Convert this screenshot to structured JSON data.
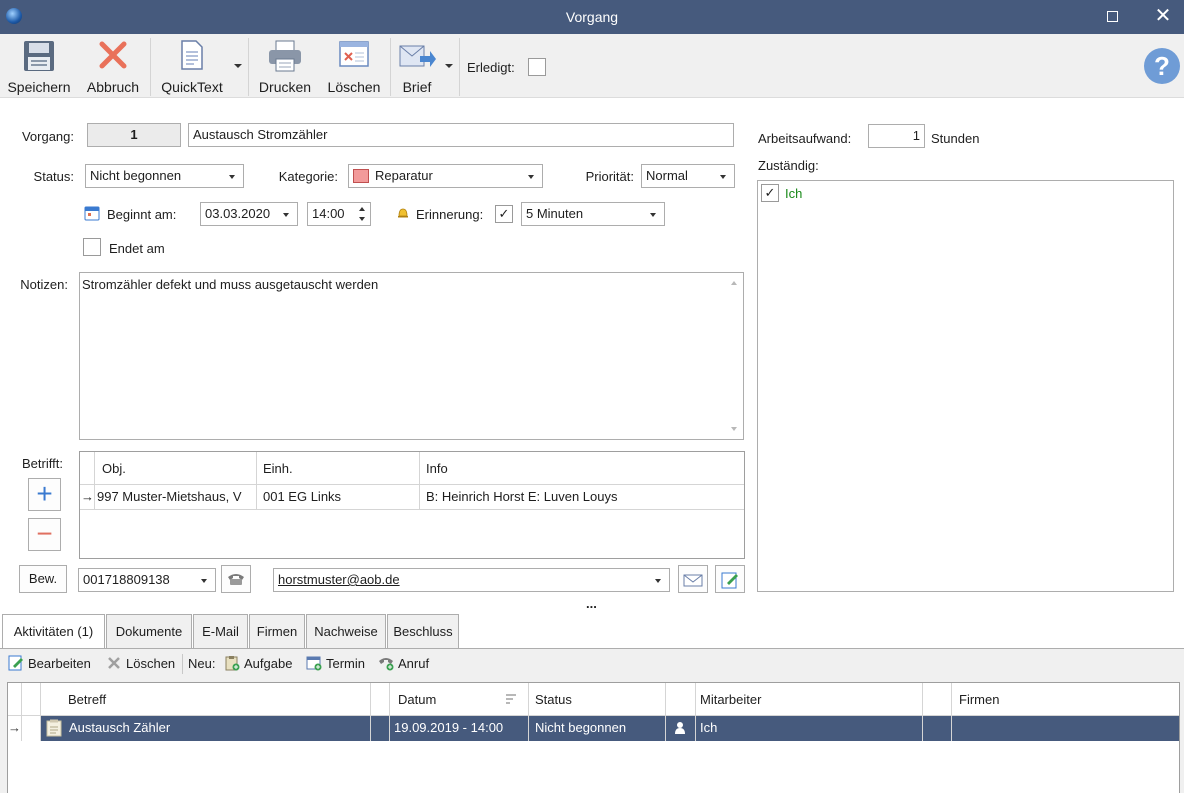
{
  "window": {
    "title": "Vorgang"
  },
  "toolbar": {
    "save": "Speichern",
    "cancel": "Abbruch",
    "quicktext": "QuickText",
    "print": "Drucken",
    "delete": "Löschen",
    "letter": "Brief",
    "done_label": "Erledigt:"
  },
  "form": {
    "vorgang_label": "Vorgang:",
    "vorgang_number": "1",
    "vorgang_title": "Austausch Stromzähler",
    "status_label": "Status:",
    "status_value": "Nicht begonnen",
    "category_label": "Kategorie:",
    "category_value": "Reparatur",
    "category_color": "#f29a9a",
    "priority_label": "Priorität:",
    "priority_value": "Normal",
    "begins_label": "Beginnt am:",
    "begins_date": "03.03.2020",
    "begins_time": "14:00",
    "reminder_label": "Erinnerung:",
    "reminder_value": "5 Minuten",
    "ends_label": "Endet am",
    "notes_label": "Notizen:",
    "notes_text": "Stromzähler defekt und muss ausgetauscht werden",
    "concerns_label": "Betrifft:",
    "bew_label": "Bew.",
    "phone": "001718809138",
    "email": "horstmuster@aob.de",
    "ellipsis": "..."
  },
  "concerns_table": {
    "headers": [
      "Obj.",
      "Einh.",
      "Info"
    ],
    "rows": [
      {
        "obj": "997 Muster-Mietshaus, V",
        "unit": "001 EG Links",
        "info": "B: Heinrich Horst E: Luven Louys"
      }
    ]
  },
  "right_panel": {
    "effort_label": "Arbeitsaufwand:",
    "effort_value": "1",
    "effort_unit": "Stunden",
    "responsible_label": "Zuständig:",
    "responsible_items": [
      {
        "label": "Ich",
        "checked": true
      }
    ]
  },
  "tabs": [
    "Aktivitäten (1)",
    "Dokumente",
    "E-Mail",
    "Firmen",
    "Nachweise",
    "Beschluss"
  ],
  "activity_toolbar": {
    "edit": "Bearbeiten",
    "delete": "Löschen",
    "new_label": "Neu:",
    "task": "Aufgabe",
    "appointment": "Termin",
    "call": "Anruf"
  },
  "activities_table": {
    "headers": [
      "Betreff",
      "Datum",
      "Status",
      "Mitarbeiter",
      "Firmen"
    ],
    "rows": [
      {
        "subject": "Austausch Zähler",
        "date": "19.09.2019 - 14:00",
        "status": "Nicht begonnen",
        "employee": "Ich",
        "companies": ""
      }
    ]
  },
  "colors": {
    "titlebar": "#465a7d",
    "selected_row": "#465a7d",
    "responsible_text": "#1a8a1a"
  }
}
